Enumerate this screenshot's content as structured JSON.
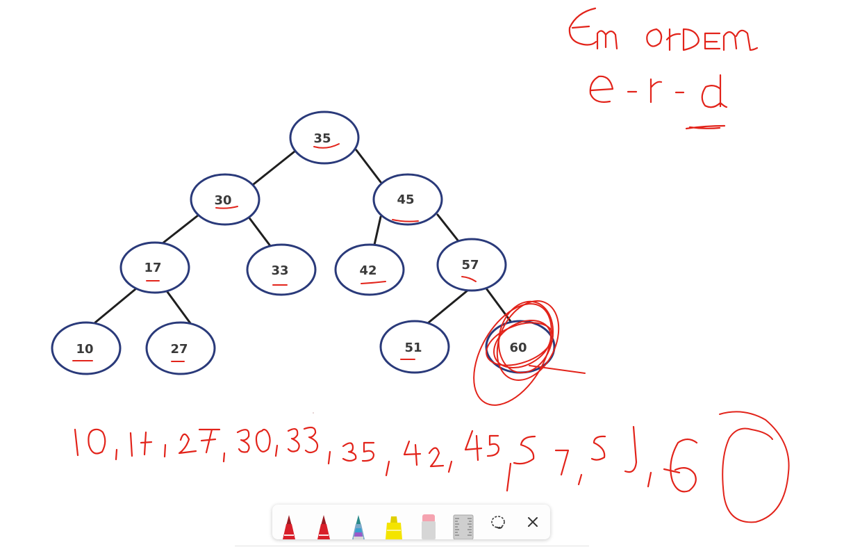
{
  "tree": {
    "nodes": [
      "35",
      "30",
      "45",
      "17",
      "33",
      "42",
      "57",
      "10",
      "27",
      "51",
      "60"
    ]
  },
  "toolbar": {
    "tools": [
      {
        "name": "pen-red-icon",
        "color": "#d81f2a"
      },
      {
        "name": "pen-red-2-icon",
        "color": "#d81f2a"
      },
      {
        "name": "pen-galaxy-icon",
        "color": "#3a8fd0"
      },
      {
        "name": "highlighter-yellow-icon",
        "color": "#f4e400"
      },
      {
        "name": "eraser-icon",
        "color": "#f5a3b0"
      },
      {
        "name": "ruler-icon",
        "color": "#bdbdbd"
      },
      {
        "name": "lasso-select-icon",
        "color": "#333333"
      },
      {
        "name": "close-icon",
        "color": "#333333"
      }
    ]
  },
  "colors": {
    "ink": "#e2231a",
    "node_border": "#2a3a7a",
    "edge": "#1f1f1f"
  }
}
